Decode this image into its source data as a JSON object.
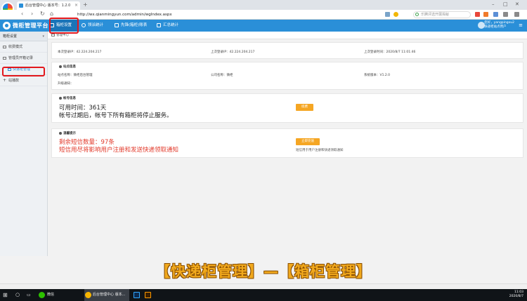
{
  "browser": {
    "tab_title": "后台管理中心 版本号：1.2.0",
    "tab_close": "×",
    "new_tab": "+",
    "url": "http://wx.qianmingyun.com/admin/wgIndex.aspx",
    "search_placeholder": "乐腾评选开展揭秘",
    "nav": {
      "back": "‹",
      "forward": "›",
      "reload": "↻",
      "home": "⌂"
    }
  },
  "app": {
    "title": "微柜管理平台",
    "menu": [
      {
        "label": "箱柜设置"
      },
      {
        "label": "领派统计"
      },
      {
        "label": "先锋(箱柜)账表"
      },
      {
        "label": "汇总统计"
      }
    ],
    "user_line1": "您好，yangpingxu2",
    "user_line2": "快递柜站点用户"
  },
  "sidebar": {
    "header": "箱柜设置",
    "items": [
      {
        "label": "收费模式"
      },
      {
        "label": "管理员开箱记录"
      },
      {
        "label": "快递柜管理"
      },
      {
        "label": "站播款"
      }
    ]
  },
  "breadcrumb": "管理中心",
  "login": {
    "current_ip": "本次登录IP：42.224.204.217",
    "last_ip": "上次登录IP：42.224.204.217",
    "last_time": "上次登录时间：2020/8/7 11:01:46"
  },
  "site_info": {
    "title": "站点信息",
    "site_name": "站点名称：微柜后台管理",
    "company": "公司名称：微柜",
    "version": "系统版本：V1.2.0",
    "upgrade": "升级通知："
  },
  "account": {
    "title": "帐号信息",
    "available": "可用时间：361天",
    "warning": "帐号过期后，帐号下所有箱柜将停止服务。",
    "renew_button": "续费"
  },
  "sms": {
    "title": "温馨提示",
    "remaining": "剩余短信数量：97条",
    "warning": "短信用尽将影响用户注册和发送快递领取通知",
    "recharge_button": "立即充值",
    "note": "短信用于用户注册和快递领取通知"
  },
  "caption": "【快递柜管理】—【箱柜管理】",
  "taskbar": {
    "wechat": "微信",
    "browser_task": "后台管理中心 版本...",
    "time": "11:03",
    "date": "2020/8/7"
  },
  "colors": {
    "primary": "#2a8fd8",
    "accent": "#f5a623",
    "alert": "#e23a2b",
    "highlight": "#e2171c"
  }
}
